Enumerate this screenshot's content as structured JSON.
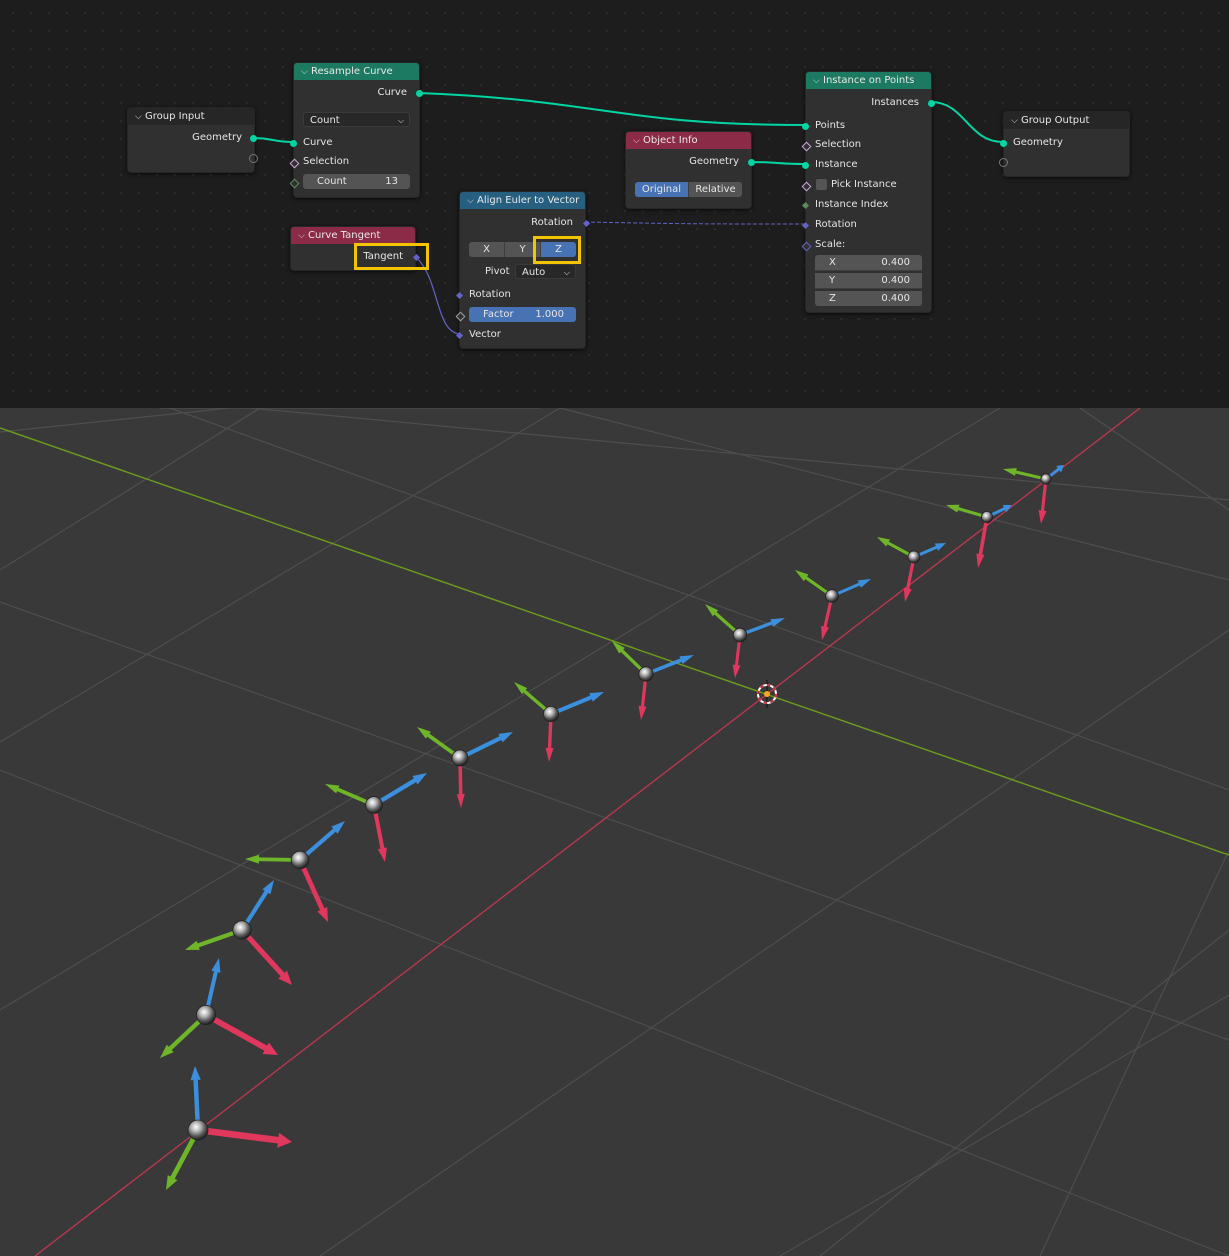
{
  "node_editor": {
    "colors": {
      "geometry_socket": "#00d6a3",
      "vector_socket": "#6363c7",
      "boolean_socket": "#cca6d6",
      "integer_socket": "#598c5c",
      "float_socket": "#a1a1a1",
      "highlight": "#f5c400",
      "active_button": "#4772b3"
    },
    "nodes": {
      "group_input": {
        "title": "Group Input",
        "outputs": [
          "Geometry"
        ]
      },
      "resample_curve": {
        "title": "Resample Curve",
        "outputs": [
          "Curve"
        ],
        "mode": "Count",
        "inputs": [
          "Curve",
          "Selection"
        ],
        "count_label": "Count",
        "count_value": "13"
      },
      "curve_tangent": {
        "title": "Curve Tangent",
        "outputs": [
          "Tangent"
        ]
      },
      "align_euler": {
        "title": "Align Euler to Vector",
        "outputs": [
          "Rotation"
        ],
        "axis_options": [
          "X",
          "Y",
          "Z"
        ],
        "axis_selected": "Z",
        "pivot_label": "Pivot",
        "pivot_value": "Auto",
        "inputs": [
          "Rotation",
          "Vector"
        ],
        "factor_label": "Factor",
        "factor_value": "1.000"
      },
      "object_info": {
        "title": "Object Info",
        "outputs": [
          "Geometry"
        ],
        "transform_options": [
          "Original",
          "Relative"
        ],
        "transform_selected": "Original"
      },
      "instance_on_points": {
        "title": "Instance on Points",
        "outputs": [
          "Instances"
        ],
        "inputs": [
          "Points",
          "Selection",
          "Instance",
          "Pick Instance",
          "Instance Index",
          "Rotation",
          "Scale:"
        ],
        "scale": [
          {
            "axis": "X",
            "value": "0.400"
          },
          {
            "axis": "Y",
            "value": "0.400"
          },
          {
            "axis": "Z",
            "value": "0.400"
          }
        ]
      },
      "group_output": {
        "title": "Group Output",
        "inputs": [
          "Geometry"
        ]
      }
    }
  },
  "viewport": {
    "colors": {
      "background": "#393939",
      "grid": "#4e4e4e",
      "x_axis": "#c0374f",
      "y_axis": "#6a9a1e",
      "arrow_x": "#e0375d",
      "arrow_y": "#6fb52a",
      "arrow_z": "#3b8fdc"
    },
    "instance_count": 13
  }
}
